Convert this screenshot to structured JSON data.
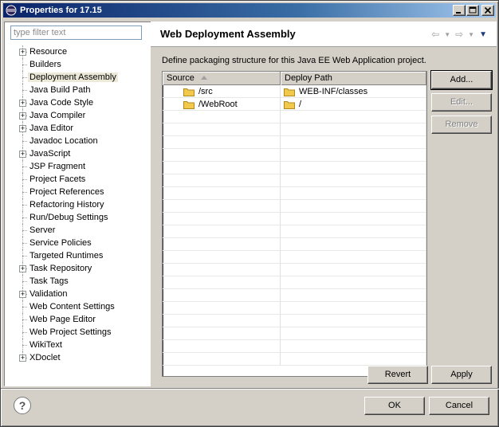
{
  "window": {
    "title": "Properties for 17.15"
  },
  "filter": {
    "placeholder": "type filter text"
  },
  "tree": [
    {
      "label": "Resource",
      "expandable": true
    },
    {
      "label": "Builders",
      "expandable": false
    },
    {
      "label": "Deployment Assembly",
      "expandable": false,
      "selected": true
    },
    {
      "label": "Java Build Path",
      "expandable": false
    },
    {
      "label": "Java Code Style",
      "expandable": true
    },
    {
      "label": "Java Compiler",
      "expandable": true
    },
    {
      "label": "Java Editor",
      "expandable": true
    },
    {
      "label": "Javadoc Location",
      "expandable": false
    },
    {
      "label": "JavaScript",
      "expandable": true
    },
    {
      "label": "JSP Fragment",
      "expandable": false
    },
    {
      "label": "Project Facets",
      "expandable": false
    },
    {
      "label": "Project References",
      "expandable": false
    },
    {
      "label": "Refactoring History",
      "expandable": false
    },
    {
      "label": "Run/Debug Settings",
      "expandable": false
    },
    {
      "label": "Server",
      "expandable": false
    },
    {
      "label": "Service Policies",
      "expandable": false
    },
    {
      "label": "Targeted Runtimes",
      "expandable": false
    },
    {
      "label": "Task Repository",
      "expandable": true
    },
    {
      "label": "Task Tags",
      "expandable": false
    },
    {
      "label": "Validation",
      "expandable": true
    },
    {
      "label": "Web Content Settings",
      "expandable": false
    },
    {
      "label": "Web Page Editor",
      "expandable": false
    },
    {
      "label": "Web Project Settings",
      "expandable": false
    },
    {
      "label": "WikiText",
      "expandable": false
    },
    {
      "label": "XDoclet",
      "expandable": true
    }
  ],
  "page": {
    "title": "Web Deployment Assembly",
    "description": "Define packaging structure for this Java EE Web Application project."
  },
  "table": {
    "columns": [
      "Source",
      "Deploy Path"
    ],
    "rows": [
      {
        "source": "/src",
        "deploy_path": "WEB-INF/classes"
      },
      {
        "source": "/WebRoot",
        "deploy_path": "/"
      }
    ]
  },
  "buttons": {
    "add": "Add...",
    "edit": "Edit...",
    "remove": "Remove",
    "revert": "Revert",
    "apply": "Apply",
    "ok": "OK",
    "cancel": "Cancel",
    "help": "?"
  },
  "colors": {
    "titlebar_start": "#0a246a",
    "titlebar_end": "#a6caf0",
    "dialog_bg": "#d4d0c8",
    "folder": "#f2c94c"
  }
}
